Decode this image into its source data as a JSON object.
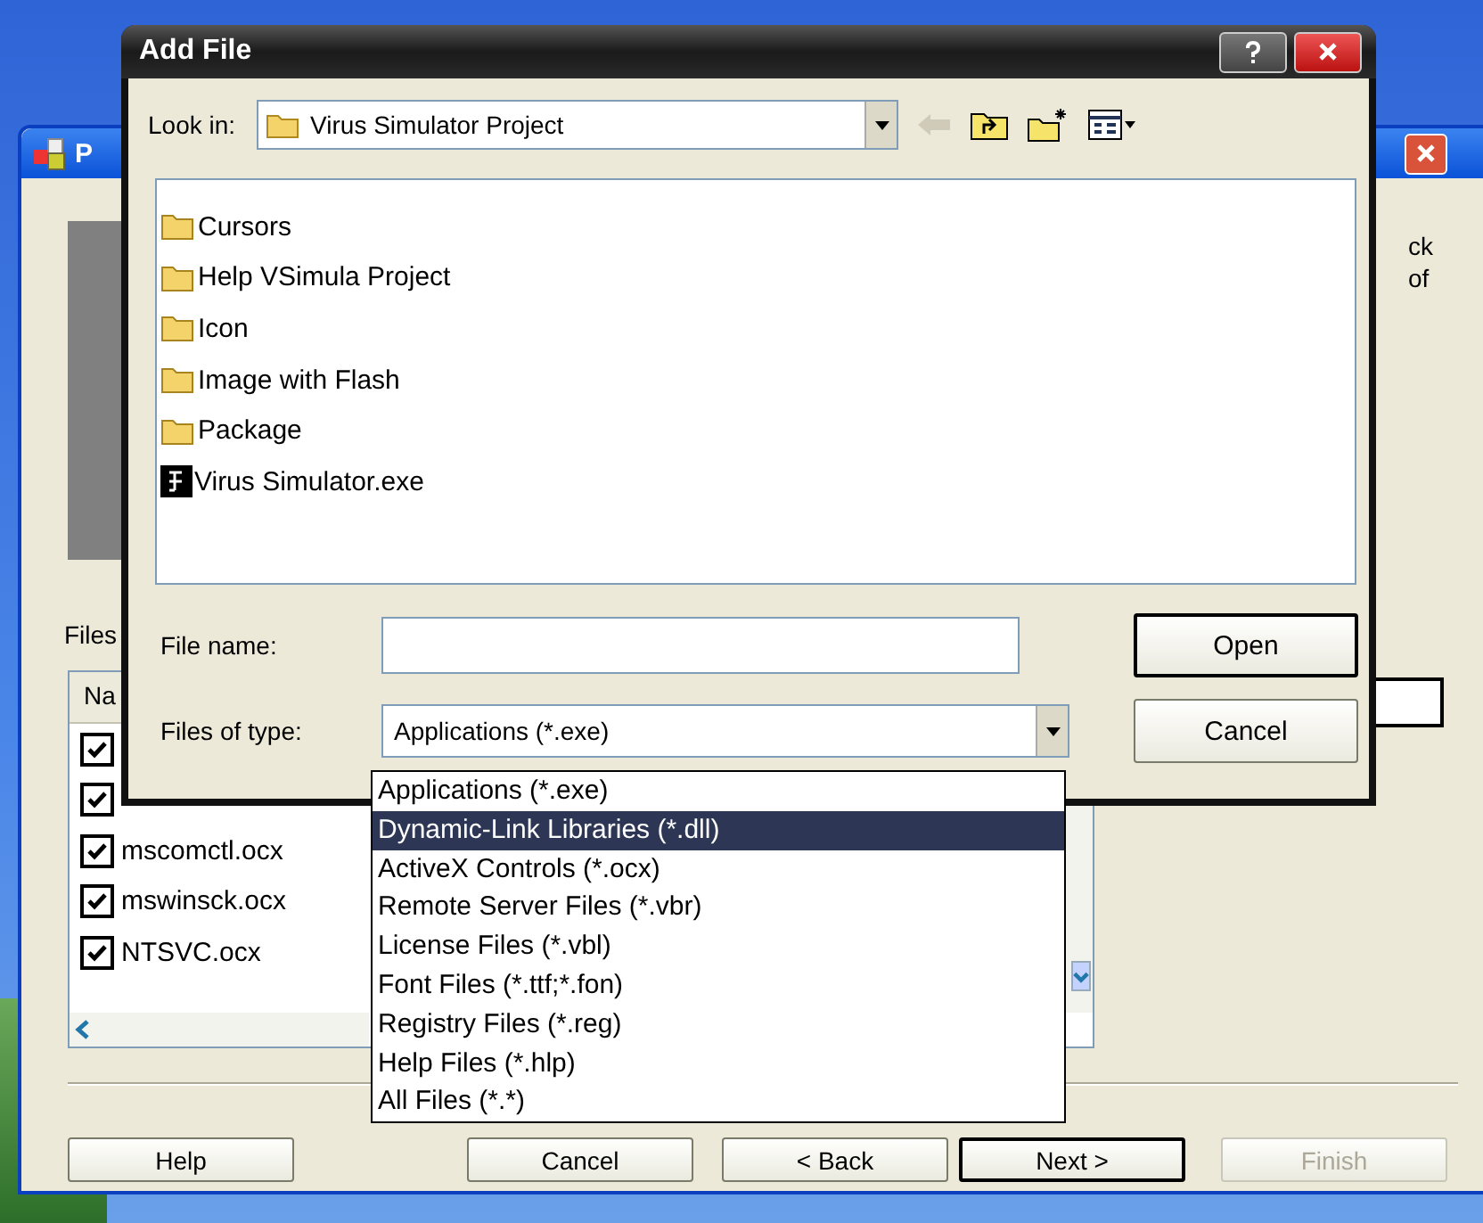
{
  "back_window": {
    "title": "P",
    "side_texts": [
      "ck",
      "of"
    ],
    "files_label": "Files",
    "list_header": "Na",
    "files": [
      {
        "checked": true
      },
      {
        "checked": true
      },
      {
        "name": "mscomctl.ocx",
        "checked": true
      },
      {
        "name": "mswinsck.ocx",
        "checked": true
      },
      {
        "name": "NTSVC.ocx",
        "checked": true
      }
    ],
    "buttons": [
      {
        "label": "Help",
        "default": false,
        "disabled": false
      },
      {
        "label": "Cancel",
        "default": false,
        "disabled": false
      },
      {
        "label": "< Back",
        "default": false,
        "disabled": false
      },
      {
        "label": "Next >",
        "default": true,
        "disabled": false
      },
      {
        "label": "Finish",
        "default": false,
        "disabled": true
      }
    ]
  },
  "dialog": {
    "title": "Add File",
    "look_in": {
      "label": "Look in:",
      "value": "Virus Simulator Project"
    },
    "items": [
      {
        "name": "Cursors",
        "kind": "folder"
      },
      {
        "name": "Help VSimula Project",
        "kind": "folder"
      },
      {
        "name": "Icon",
        "kind": "folder"
      },
      {
        "name": "Image with Flash",
        "kind": "folder"
      },
      {
        "name": "Package",
        "kind": "folder"
      },
      {
        "name": "Virus Simulator.exe",
        "kind": "exe"
      }
    ],
    "file_name": {
      "label": "File name:"
    },
    "files_of_type": {
      "label": "Files of type:",
      "value": "Applications (*.exe)"
    },
    "type_options": [
      {
        "label": "Applications (*.exe)",
        "selected": false
      },
      {
        "label": "Dynamic-Link Libraries (*.dll)",
        "selected": true
      },
      {
        "label": "ActiveX Controls (*.ocx)",
        "selected": false
      },
      {
        "label": "Remote Server Files (*.vbr)",
        "selected": false
      },
      {
        "label": "License Files (*.vbl)",
        "selected": false
      },
      {
        "label": "Font Files (*.ttf;*.fon)",
        "selected": false
      },
      {
        "label": "Registry Files (*.reg)",
        "selected": false
      },
      {
        "label": "Help Files (*.hlp)",
        "selected": false
      },
      {
        "label": "All Files (*.*)",
        "selected": false
      }
    ],
    "buttons": [
      {
        "label": "Open",
        "default": true
      },
      {
        "label": "Cancel",
        "default": false
      }
    ]
  }
}
